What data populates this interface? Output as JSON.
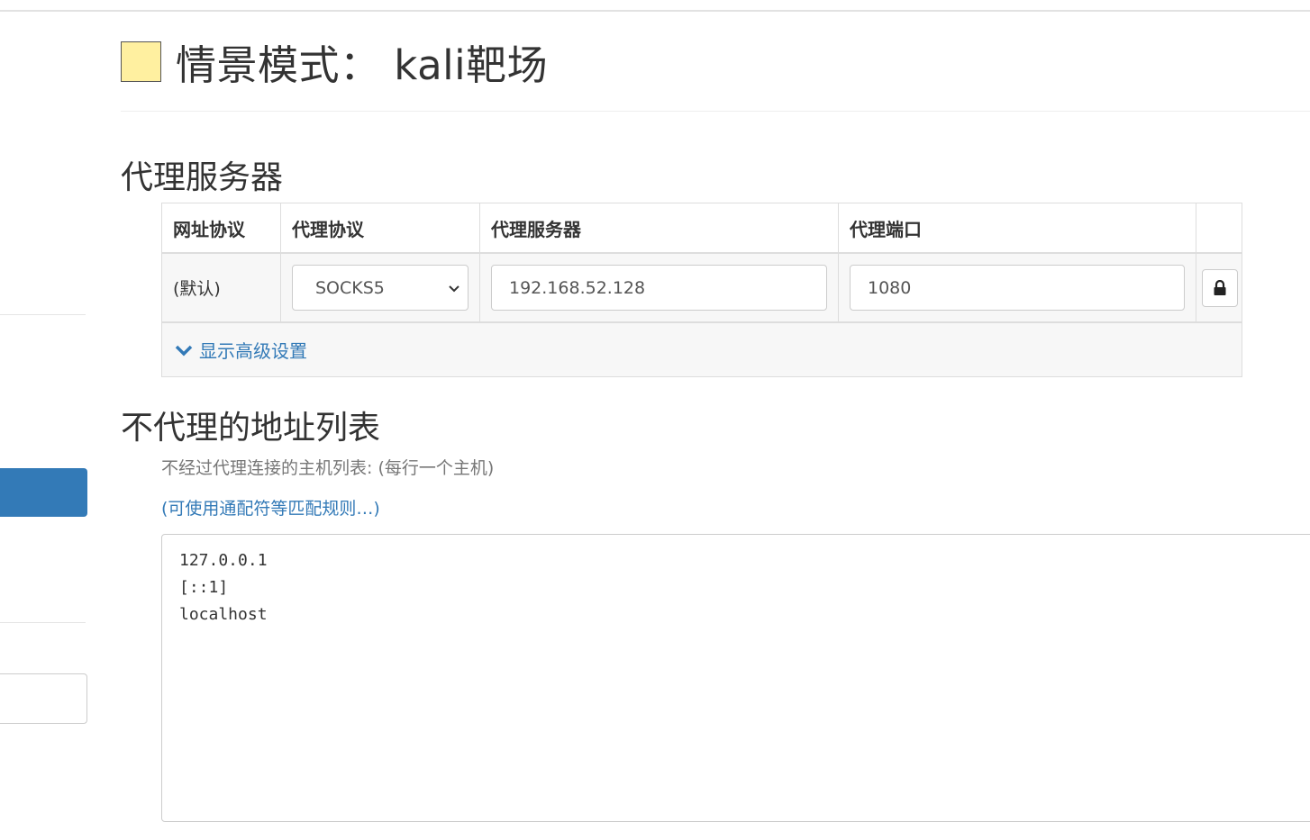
{
  "profile": {
    "title": "情景模式： kali靶场",
    "color": "#fff0a0"
  },
  "proxy_section": {
    "heading": "代理服务器",
    "columns": [
      "网址协议",
      "代理协议",
      "代理服务器",
      "代理端口"
    ],
    "row": {
      "url_scheme": "(默认)",
      "protocol": "SOCKS5",
      "server": "192.168.52.128",
      "port": "1080"
    },
    "advanced_label": "显示高级设置"
  },
  "bypass_section": {
    "heading": "不代理的地址列表",
    "hint": "不经过代理连接的主机列表: (每行一个主机)",
    "pattern_link": "(可使用通配符等匹配规则…)",
    "list": "127.0.0.1\n[::1]\nlocalhost"
  },
  "colors": {
    "accent": "#337ab7"
  }
}
